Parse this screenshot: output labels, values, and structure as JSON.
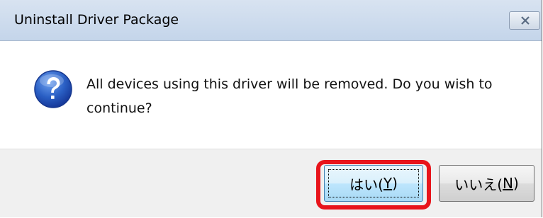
{
  "window": {
    "title": "Uninstall Driver Package",
    "close_glyph": "✕"
  },
  "message": {
    "icon": "question-icon",
    "text": "All devices using this driver will be removed.  Do you wish to continue?"
  },
  "buttons": {
    "yes": {
      "label_prefix": "はい(",
      "mnemonic": "Y",
      "label_suffix": ")"
    },
    "no": {
      "label_prefix": "いいえ(",
      "mnemonic": "N",
      "label_suffix": ")"
    }
  },
  "annotation": {
    "highlight_color": "#e8141b",
    "target": "yes-button"
  },
  "colors": {
    "titlebar": "#c4d5ea",
    "button_bar": "#f0f0f0",
    "icon_blue": "#1d4fa8"
  }
}
